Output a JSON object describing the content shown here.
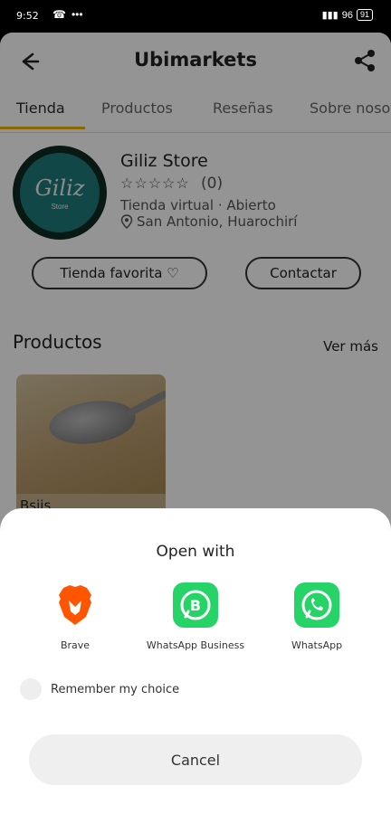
{
  "status_bar": {
    "time": "9:52",
    "battery": "91",
    "network": "96"
  },
  "header": {
    "title": "Ubimarkets"
  },
  "tabs": [
    {
      "label": "Tienda",
      "active": true
    },
    {
      "label": "Productos",
      "active": false
    },
    {
      "label": "Reseñas",
      "active": false
    },
    {
      "label": "Sobre nosotros",
      "active": false
    }
  ],
  "store": {
    "name": "Giliz Store",
    "stars": "☆☆☆☆☆",
    "rating": "(0)",
    "meta": "Tienda virtual · Abierto",
    "location": "San Antonio, Huarochirí",
    "logo_text": "Giliz",
    "logo_sub": "Store"
  },
  "actions": {
    "favorite": "Tienda favorita ♡",
    "contact": "Contactar"
  },
  "products_section": {
    "title": "Productos",
    "see_more": "Ver más",
    "items": [
      {
        "name": "Bsjjs"
      }
    ]
  },
  "open_with": {
    "title": "Open with",
    "apps": [
      {
        "label": "Brave",
        "icon": "brave-icon",
        "color": "#ff5500"
      },
      {
        "label": "WhatsApp Business",
        "icon": "whatsapp-business-icon",
        "color": "#25d366"
      },
      {
        "label": "WhatsApp",
        "icon": "whatsapp-icon",
        "color": "#25d366"
      }
    ],
    "remember": "Remember my choice",
    "cancel": "Cancel"
  },
  "colors": {
    "accent": "#f3b400"
  }
}
